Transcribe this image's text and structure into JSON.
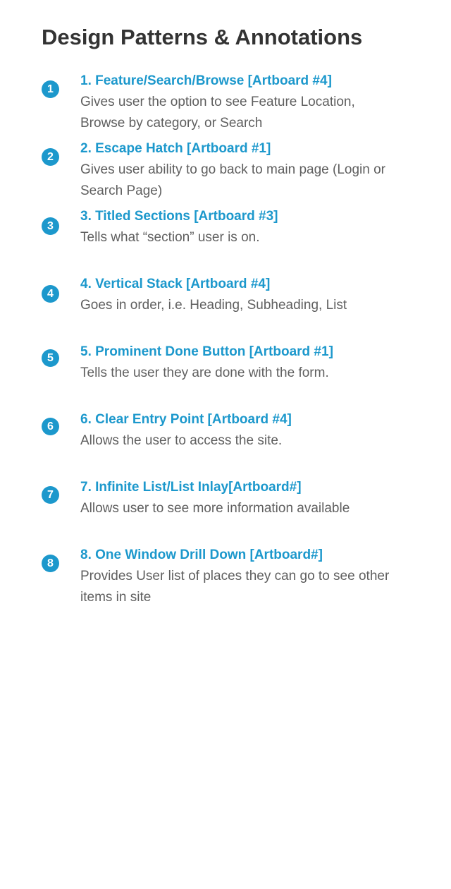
{
  "page_title": "Design Patterns & Annotations",
  "colors": {
    "accent": "#1c98cc",
    "heading": "#333333",
    "body_text": "#5f5f5f",
    "background": "#ffffff"
  },
  "annotations": [
    {
      "number": "1",
      "title": "1. Feature/Search/Browse [Artboard #4]",
      "description": "Gives user the option to see Feature Location, Browse by category, or Search"
    },
    {
      "number": "2",
      "title": "2. Escape Hatch [Artboard #1]",
      "description": "Gives user ability to go back to main page (Login or Search Page)"
    },
    {
      "number": "3",
      "title": "3. Titled Sections [Artboard #3]",
      "description": "Tells what “section” user is on."
    },
    {
      "number": "4",
      "title": "4. Vertical Stack [Artboard #4]",
      "description": "Goes in order, i.e. Heading, Subheading, List"
    },
    {
      "number": "5",
      "title": "5. Prominent Done Button [Artboard #1]",
      "description": "Tells the user they are done with the form."
    },
    {
      "number": "6",
      "title": "6. Clear Entry Point [Artboard #4]",
      "description": "Allows the user to access the site."
    },
    {
      "number": "7",
      "title": "7. Infinite List/List Inlay[Artboard#]",
      "description": "Allows user to see more information available"
    },
    {
      "number": "8",
      "title": "8. One Window Drill Down [Artboard#]",
      "description": "Provides User list of places they can go to see other items in site"
    }
  ]
}
